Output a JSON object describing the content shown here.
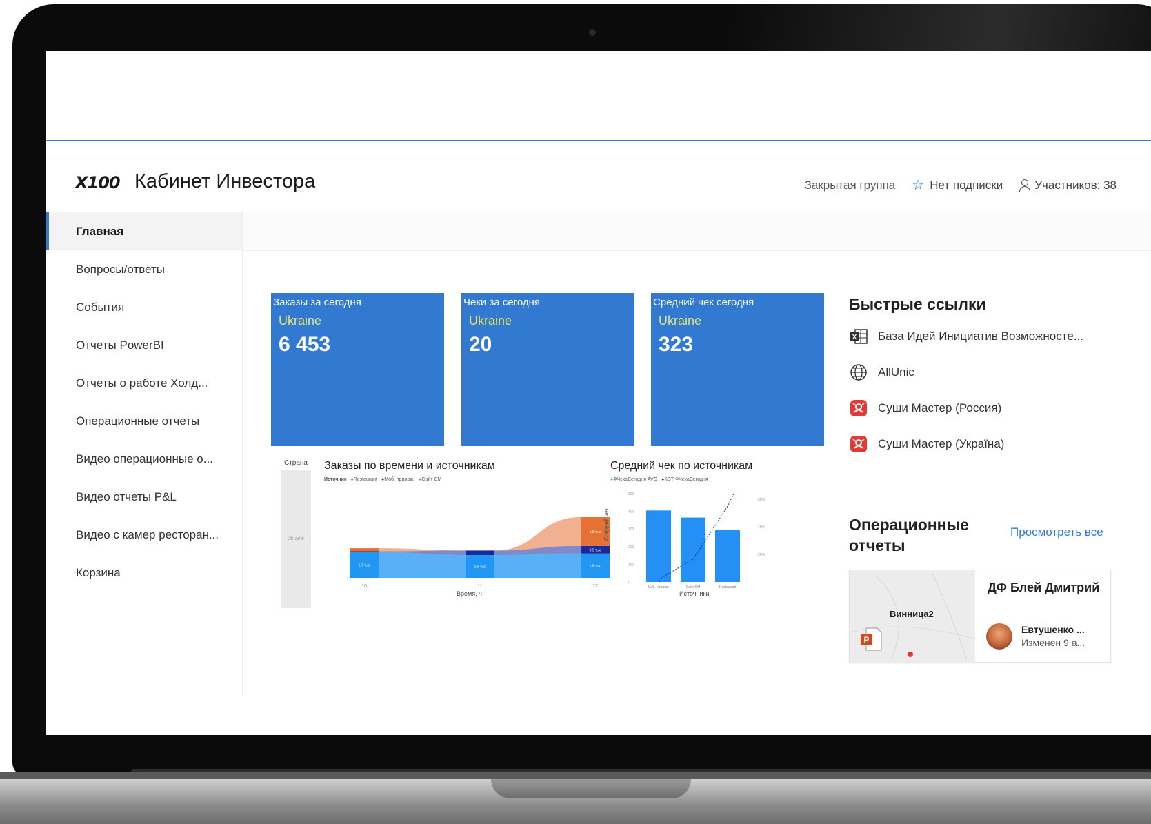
{
  "header": {
    "logo": "X100",
    "title": "Кабинет Инвестора",
    "group_type": "Закрытая группа",
    "subscription": "Нет подписки",
    "members": "Участников: 38"
  },
  "sidebar": {
    "items": [
      {
        "label": "Главная",
        "active": true
      },
      {
        "label": "Вопросы/ответы"
      },
      {
        "label": "События"
      },
      {
        "label": "Отчеты PowerBI"
      },
      {
        "label": "Отчеты о работе Холд..."
      },
      {
        "label": "Операционные отчеты"
      },
      {
        "label": "Видео операционные о..."
      },
      {
        "label": "Видео отчеты P&L"
      },
      {
        "label": "Видео с камер ресторан..."
      },
      {
        "label": "Корзина"
      }
    ]
  },
  "tiles": [
    {
      "title": "Заказы за сегодня",
      "region": "Ukraine",
      "value": "6 453"
    },
    {
      "title": "Чеки за сегодня",
      "region": "Ukraine",
      "value": "20"
    },
    {
      "title": "Средний чек сегодня",
      "region": "Ukraine",
      "value": "323"
    }
  ],
  "colors": {
    "accent": "#2f7cd1",
    "tile": "#3179d1",
    "tile_sub": "#e6e26a"
  },
  "chart_data": [
    {
      "type": "area",
      "title": "Заказы по времени и источникам",
      "side_label": "Страна",
      "side_value": "Ukraine",
      "legend_title": "Источник",
      "legend": [
        "Restaurant",
        "Моб. прилож.",
        "Сайт СМ"
      ],
      "xlabel": "Время, ч",
      "categories": [
        "10",
        "11",
        "12"
      ],
      "series": [
        {
          "name": "Restaurant",
          "values": [
            1.7,
            1.5,
            1.6
          ]
        },
        {
          "name": "Моб. прилож.",
          "values": [
            0.05,
            0.3,
            0.5
          ]
        },
        {
          "name": "Сайт СМ",
          "values": [
            0.2,
            0.0,
            1.9
          ]
        }
      ],
      "data_labels": [
        "1,7 тыс",
        "1,5 тыс",
        "1,6 тыс",
        "0,5 тыс",
        "1,9 тыс"
      ]
    },
    {
      "type": "bar",
      "title": "Средний чек по источникам",
      "legend": [
        "ФЧекаСегодня AVG",
        "КОТ ФЧекаСегодня"
      ],
      "xlabel": "Источники",
      "ylabel": "Средний чек",
      "categories": [
        "Моб. прилож.",
        "Сайт СМ",
        "Restaurant"
      ],
      "values": [
        405,
        365,
        295
      ],
      "line_values": [
        2,
        18,
        60
      ],
      "y_ticks": [
        "0",
        "100",
        "200",
        "300",
        "400",
        "500"
      ],
      "y2_ticks": [
        "20%",
        "40%",
        "60%"
      ],
      "ylim": [
        0,
        500
      ]
    }
  ],
  "quick_links": {
    "heading": "Быстрые ссылки",
    "items": [
      {
        "label": "База Идей Инициатив Возможносте...",
        "icon": "excel-icon"
      },
      {
        "label": "AllUnic",
        "icon": "globe-icon"
      },
      {
        "label": "Суши Мастер (Россия)",
        "icon": "sushi-master-icon"
      },
      {
        "label": "Суши Мастер (Україна)",
        "icon": "sushi-master-icon"
      }
    ]
  },
  "operational_reports": {
    "heading": "Операционные отчеты",
    "view_all": "Просмотреть все",
    "card": {
      "thumb_title": "Винница2",
      "name": "ДФ Блей Дмитрий",
      "author": "Евтушенко ...",
      "modified": "Изменен 9 а..."
    }
  }
}
